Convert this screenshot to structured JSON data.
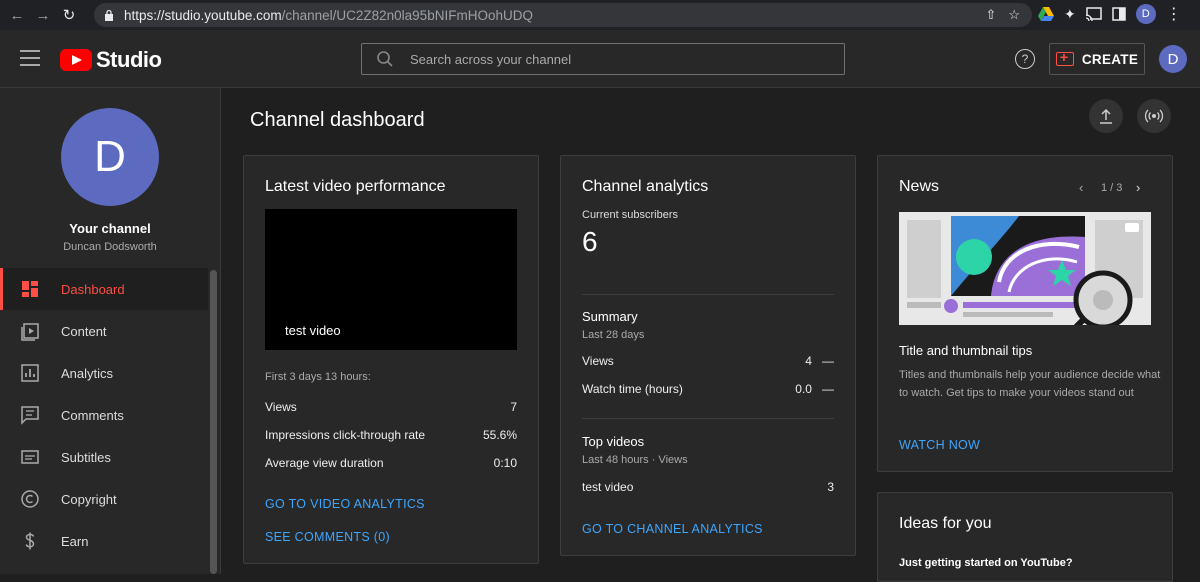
{
  "browser": {
    "url_host": "https://studio.youtube.com",
    "url_path": "/channel/UC2Z82n0la95bNIFmHOohUDQ",
    "profile_initial": "D"
  },
  "header": {
    "logo_text": "Studio",
    "search_placeholder": "Search across your channel",
    "help_glyph": "?",
    "create_label": "CREATE",
    "avatar_initial": "D"
  },
  "sidebar": {
    "avatar_initial": "D",
    "channel_title": "Your channel",
    "channel_name": "Duncan Dodsworth",
    "items": [
      {
        "label": "Dashboard",
        "icon": "dashboard-icon",
        "active": true
      },
      {
        "label": "Content",
        "icon": "content-icon",
        "active": false
      },
      {
        "label": "Analytics",
        "icon": "analytics-icon",
        "active": false
      },
      {
        "label": "Comments",
        "icon": "comments-icon",
        "active": false
      },
      {
        "label": "Subtitles",
        "icon": "subtitles-icon",
        "active": false
      },
      {
        "label": "Copyright",
        "icon": "copyright-icon",
        "active": false
      },
      {
        "label": "Earn",
        "icon": "earn-icon",
        "active": false
      }
    ]
  },
  "main": {
    "title": "Channel dashboard"
  },
  "latest_video": {
    "title": "Latest video performance",
    "video_title": "test video",
    "period": "First 3 days 13 hours:",
    "stats": [
      {
        "label": "Views",
        "value": "7"
      },
      {
        "label": "Impressions click-through rate",
        "value": "55.6%"
      },
      {
        "label": "Average view duration",
        "value": "0:10"
      }
    ],
    "link_analytics": "GO TO VIDEO ANALYTICS",
    "link_comments": "SEE COMMENTS (0)"
  },
  "channel_analytics": {
    "title": "Channel analytics",
    "subs_label": "Current subscribers",
    "subs_value": "6",
    "summary_title": "Summary",
    "summary_period": "Last 28 days",
    "summary": [
      {
        "label": "Views",
        "value": "4",
        "trend": "—"
      },
      {
        "label": "Watch time (hours)",
        "value": "0.0",
        "trend": "—"
      }
    ],
    "top_title": "Top videos",
    "top_period": "Last 48 hours · Views",
    "top_videos": [
      {
        "label": "test video",
        "value": "3"
      }
    ],
    "link": "GO TO CHANNEL ANALYTICS"
  },
  "news": {
    "title": "News",
    "pager": "1 / 3",
    "headline": "Title and thumbnail tips",
    "body": "Titles and thumbnails help your audience decide what to watch. Get tips to make your videos stand out",
    "link": "WATCH NOW"
  },
  "ideas": {
    "title": "Ideas for you",
    "subtitle": "Just getting started on YouTube?"
  },
  "colors": {
    "accent_red": "#ff4e45",
    "link_blue": "#3ea6ff",
    "avatar_purple": "#5c6bc0"
  }
}
